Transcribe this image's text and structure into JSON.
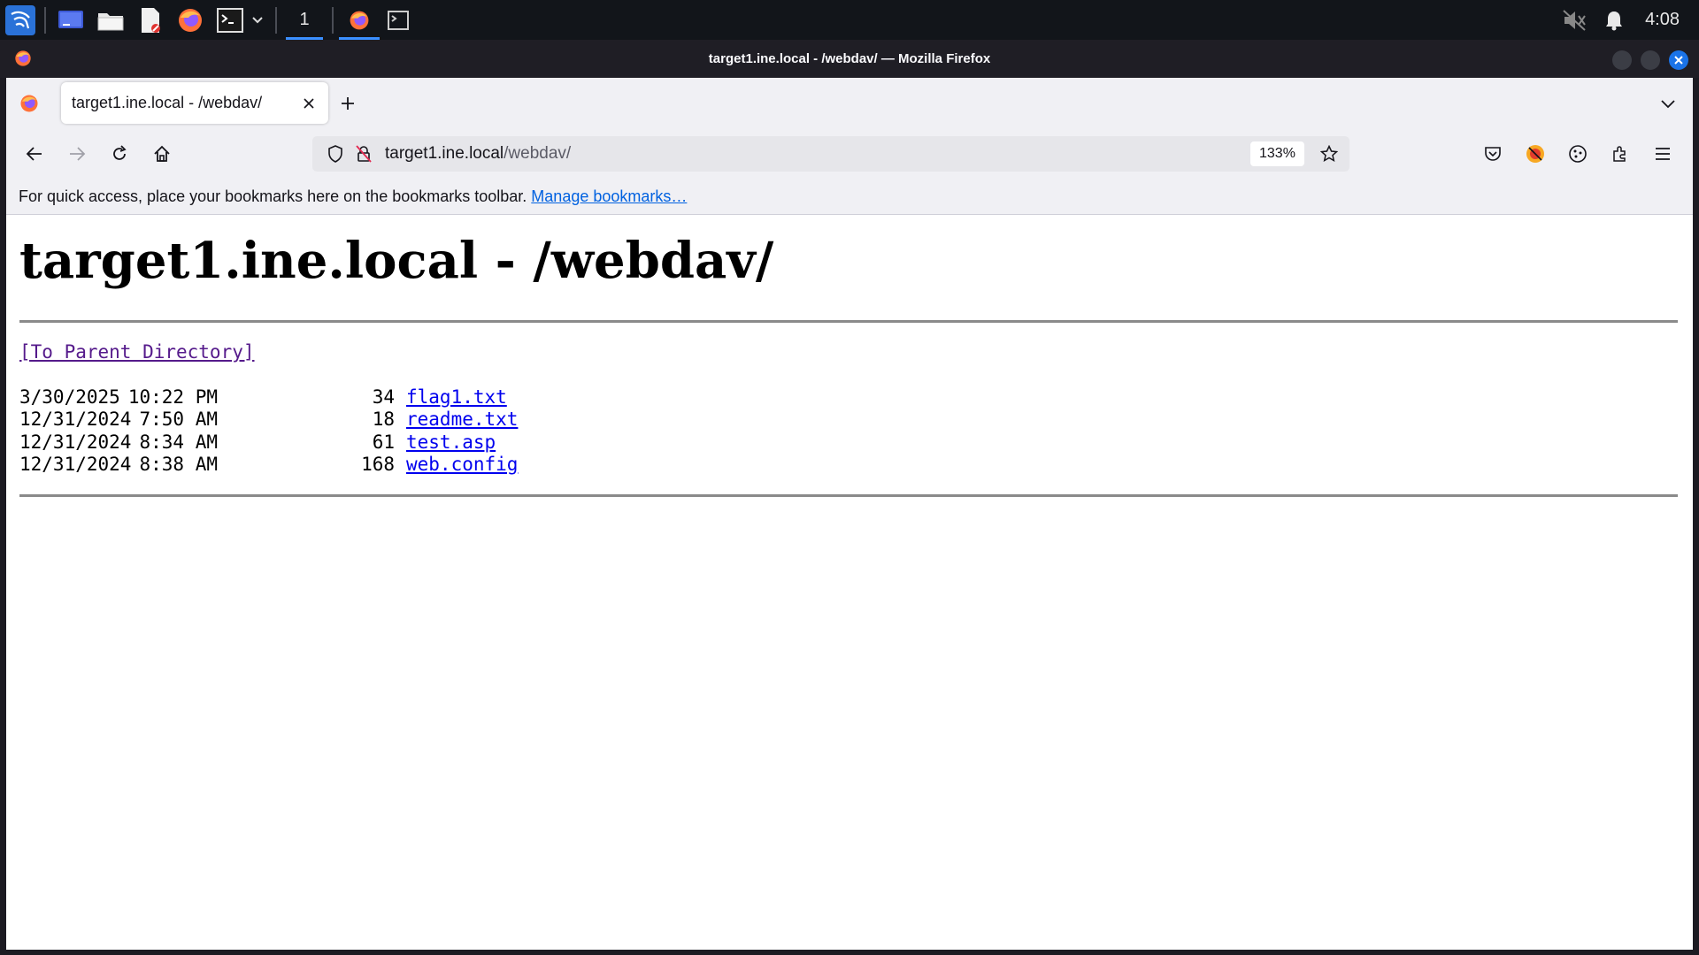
{
  "taskbar": {
    "workspace_number": "1",
    "clock": "4:08",
    "icons": [
      "kali-menu-icon",
      "desktop-icon",
      "file-manager-icon",
      "text-editor-icon",
      "firefox-icon",
      "terminal-icon",
      "dropdown-icon",
      "firefox-window-icon",
      "terminal-window-icon",
      "mute-icon",
      "notification-bell-icon"
    ]
  },
  "window": {
    "title": "target1.ine.local - /webdav/ — Mozilla Firefox"
  },
  "browser": {
    "tab": {
      "label": "target1.ine.local - /webdav/"
    },
    "url": {
      "host": "target1.ine.local",
      "path": "/webdav/"
    },
    "zoom": "133%",
    "bookmarks_bar": {
      "message": "For quick access, place your bookmarks here on the bookmarks toolbar.",
      "link": "Manage bookmarks…"
    }
  },
  "page": {
    "heading": "target1.ine.local - /webdav/",
    "parent_link": "[To Parent Directory]",
    "files": [
      {
        "date": "3/30/2025",
        "time": "10:22 PM",
        "size": "34",
        "name": "flag1.txt"
      },
      {
        "date": "12/31/2024",
        "time": "7:50 AM",
        "size": "18",
        "name": "readme.txt"
      },
      {
        "date": "12/31/2024",
        "time": "8:34 AM",
        "size": "61",
        "name": "test.asp"
      },
      {
        "date": "12/31/2024",
        "time": "8:38 AM",
        "size": "168",
        "name": "web.config"
      }
    ]
  },
  "colors": {
    "taskbar_bg": "#12151a",
    "accent": "#3a8fff",
    "link_visited": "#551a8b",
    "link": "#0000ee",
    "close_button": "#1a73e8"
  }
}
